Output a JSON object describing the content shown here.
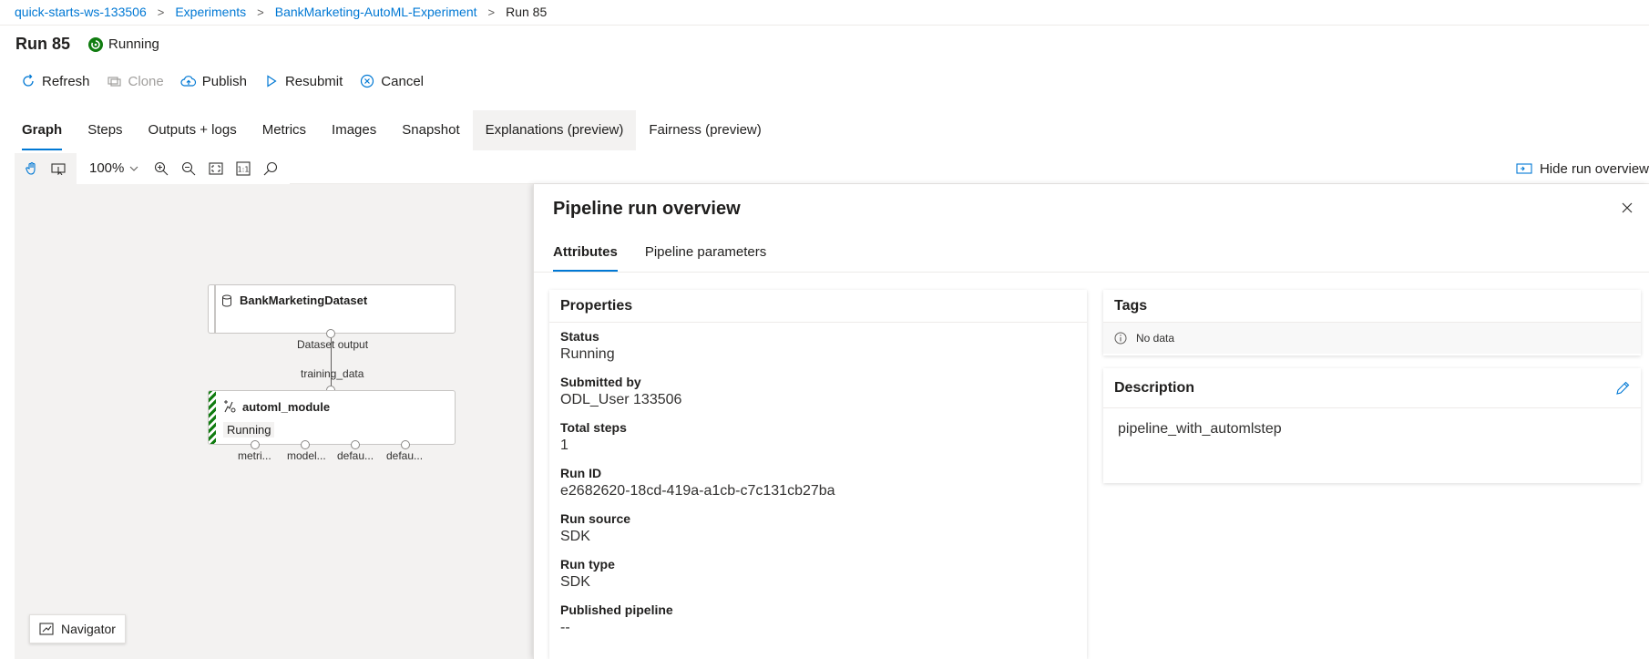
{
  "breadcrumb": {
    "workspace": "quick-starts-ws-133506",
    "experiments": "Experiments",
    "experiment": "BankMarketing-AutoML-Experiment",
    "run": "Run 85"
  },
  "header": {
    "title": "Run 85",
    "status": "Running",
    "status_color": "#107c10"
  },
  "toolbar": {
    "refresh": "Refresh",
    "clone": "Clone",
    "publish": "Publish",
    "resubmit": "Resubmit",
    "cancel": "Cancel"
  },
  "tabs": [
    "Graph",
    "Steps",
    "Outputs + logs",
    "Metrics",
    "Images",
    "Snapshot",
    "Explanations (preview)",
    "Fairness (preview)"
  ],
  "canvas": {
    "zoom": "100%",
    "hide_overview": "Hide run overview",
    "navigator": "Navigator"
  },
  "graph": {
    "dataset_node": "BankMarketingDataset",
    "dataset_output": "Dataset output",
    "edge_label": "training_data",
    "module_node": "automl_module",
    "module_status": "Running",
    "outputs": [
      "metri...",
      "model...",
      "defau...",
      "defau..."
    ]
  },
  "panel": {
    "title": "Pipeline run overview",
    "tabs": [
      "Attributes",
      "Pipeline parameters"
    ],
    "properties_title": "Properties",
    "properties": [
      {
        "label": "Status",
        "value": "Running"
      },
      {
        "label": "Submitted by",
        "value": "ODL_User 133506"
      },
      {
        "label": "Total steps",
        "value": "1"
      },
      {
        "label": "Run ID",
        "value": "e2682620-18cd-419a-a1cb-c7c131cb27ba"
      },
      {
        "label": "Run source",
        "value": "SDK"
      },
      {
        "label": "Run type",
        "value": "SDK"
      },
      {
        "label": "Published pipeline",
        "value": "--"
      }
    ],
    "tags_title": "Tags",
    "tags_empty": "No data",
    "description_title": "Description",
    "description": "pipeline_with_automlstep"
  },
  "colors": {
    "accent": "#0078d4",
    "running": "#107c10"
  }
}
